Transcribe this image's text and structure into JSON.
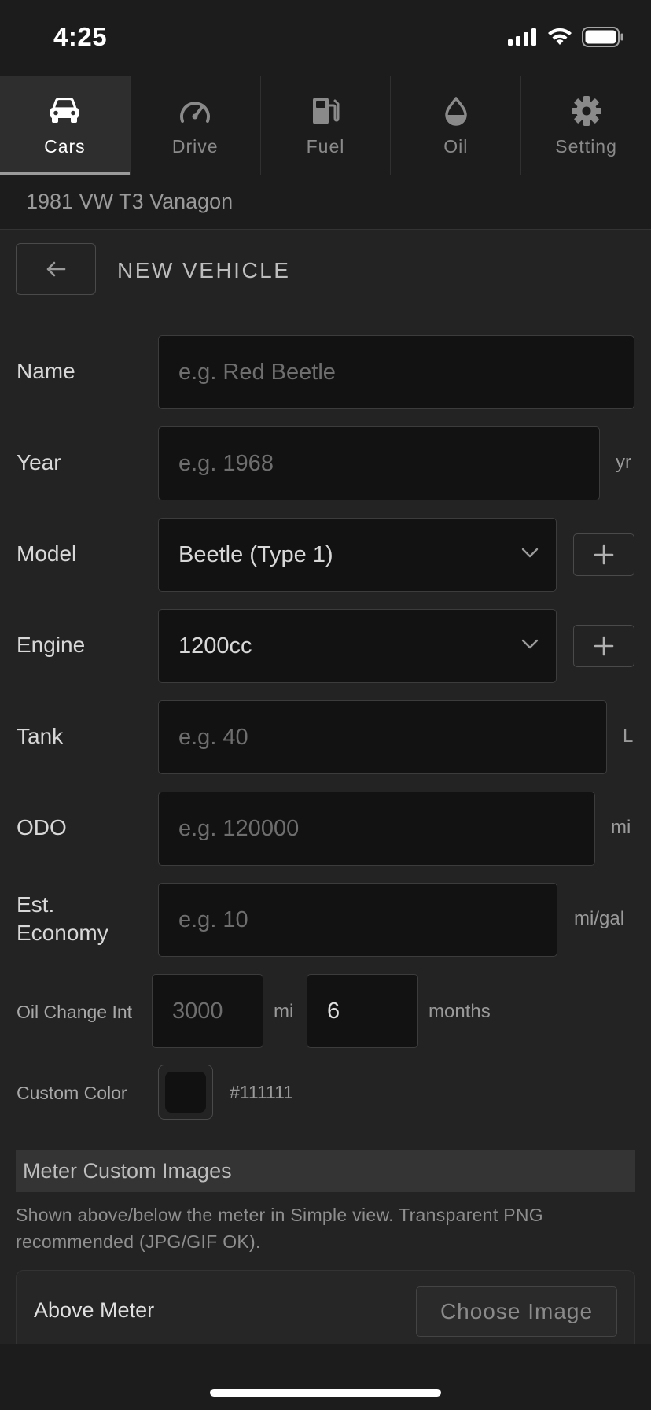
{
  "status_bar": {
    "time": "4:25",
    "icons": [
      "signal-icon",
      "wifi-icon",
      "battery-icon"
    ]
  },
  "tabs": [
    {
      "label": "Cars",
      "icon": "car-icon",
      "active": true
    },
    {
      "label": "Drive",
      "icon": "speedometer-icon",
      "active": false
    },
    {
      "label": "Fuel",
      "icon": "fuel-pump-icon",
      "active": false
    },
    {
      "label": "Oil",
      "icon": "oil-drop-icon",
      "active": false
    },
    {
      "label": "Setting",
      "icon": "gear-icon",
      "active": false
    }
  ],
  "current_vehicle": "1981 VW T3 Vanagon",
  "page": {
    "title": "NEW VEHICLE",
    "back_icon": "arrow-left-icon"
  },
  "form": {
    "name": {
      "label": "Name",
      "placeholder": "e.g. Red Beetle",
      "value": ""
    },
    "year": {
      "label": "Year",
      "placeholder": "e.g. 1968",
      "value": "",
      "unit": "yr"
    },
    "model": {
      "label": "Model",
      "selected": "Beetle (Type 1)",
      "add_icon": "plus-icon"
    },
    "engine": {
      "label": "Engine",
      "selected": "1200cc",
      "add_icon": "plus-icon"
    },
    "tank": {
      "label": "Tank",
      "placeholder": "e.g. 40",
      "value": "",
      "unit": "L"
    },
    "odo": {
      "label": "ODO",
      "placeholder": "e.g. 120000",
      "value": "",
      "unit": "mi"
    },
    "economy": {
      "label_line1": "Est.",
      "label_line2": "Economy",
      "placeholder": "e.g. 10",
      "value": "",
      "unit": "mi/gal"
    },
    "oil_change": {
      "label": "Oil Change Int",
      "distance_placeholder": "3000",
      "distance_unit": "mi",
      "months_value": "6",
      "months_unit": "months"
    },
    "custom_color": {
      "label": "Custom Color",
      "value": "#111111"
    }
  },
  "meter_images": {
    "section_title": "Meter Custom Images",
    "description": "Shown above/below the meter in Simple view. Transparent PNG recommended (JPG/GIF OK).",
    "above": {
      "label": "Above Meter",
      "button": "Choose Image"
    }
  },
  "colors": {
    "background": "#232323",
    "bar": "#1c1c1c",
    "field": "#121212",
    "active_tab": "#2e2e2e"
  }
}
